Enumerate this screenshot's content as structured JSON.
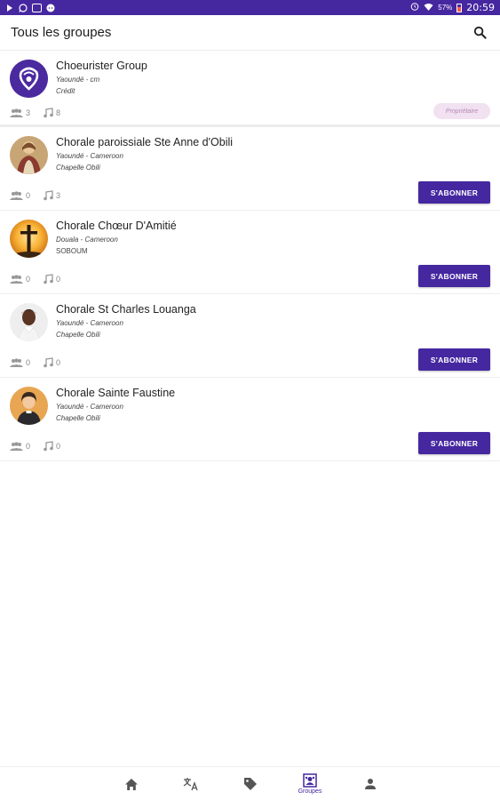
{
  "status_bar": {
    "battery": "57%",
    "time": "20:59",
    "icons": [
      "play-icon",
      "whatsapp-icon",
      "image-icon",
      "chat-icon",
      "alarm-icon",
      "wifi-icon",
      "battery-icon"
    ]
  },
  "header": {
    "title": "Tous les groupes",
    "search_icon": "search-icon"
  },
  "groups": [
    {
      "name": "Choeurister Group",
      "city": "Yaoundé - cm",
      "place": "Crédit",
      "members": "3",
      "songs": "8",
      "badge": "Propriétaire"
    },
    {
      "name": "Chorale paroissiale Ste Anne d'Obili",
      "city": "Yaoundé - Cameroon",
      "place": "Chapelle Obili",
      "members": "0",
      "songs": "3",
      "button": "S'ABONNER"
    },
    {
      "name": "Chorale Chœur D'Amitié",
      "city": "Douala - Cameroon",
      "place": "SOBOUM",
      "members": "0",
      "songs": "0",
      "button": "S'ABONNER"
    },
    {
      "name": "Chorale St Charles Louanga",
      "city": "Yaoundé - Cameroon",
      "place": "Chapelle Obili",
      "members": "0",
      "songs": "0",
      "button": "S'ABONNER"
    },
    {
      "name": "Chorale Sainte Faustine",
      "city": "Yaoundé - Cameroon",
      "place": "Chapelle Obili",
      "members": "0",
      "songs": "0",
      "button": "S'ABONNER"
    }
  ],
  "bottom_nav": {
    "items": [
      {
        "icon": "home-icon",
        "label": ""
      },
      {
        "icon": "translate-icon",
        "label": ""
      },
      {
        "icon": "tag-icon",
        "label": ""
      },
      {
        "icon": "groups-icon",
        "label": "Groupes"
      },
      {
        "icon": "person-icon",
        "label": ""
      }
    ],
    "active": "Groupes"
  },
  "colors": {
    "primary": "#4527a0",
    "badge_bg": "#f1e1f1",
    "badge_text": "#b48ab6"
  }
}
